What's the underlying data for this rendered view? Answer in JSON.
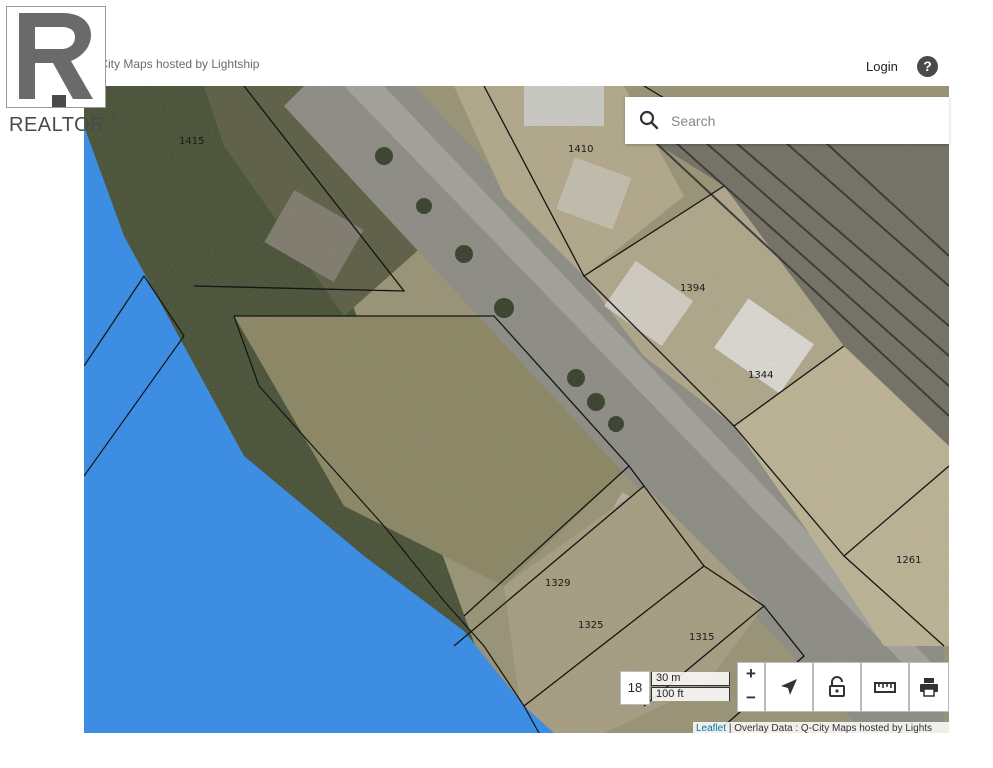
{
  "header": {
    "hosted_text": "Q-City Maps hosted by Lightship",
    "login_label": "Login",
    "help_label": "?"
  },
  "search": {
    "placeholder": "Search",
    "icon": "search-icon"
  },
  "map": {
    "parcel_labels": [
      "1415",
      "1410",
      "1394",
      "1344",
      "1329",
      "1325",
      "1315",
      "1261"
    ],
    "water_color": "#3d8ee3",
    "parcel_line_color": "#141414"
  },
  "controls": {
    "zoom_level": "18",
    "scale_metric": "30 m",
    "scale_imperial": "100 ft",
    "zoom_in": "+",
    "zoom_out": "−",
    "buttons": [
      "locate-icon",
      "lock-icon",
      "ruler-icon",
      "print-icon"
    ]
  },
  "attribution": {
    "leaflet": "Leaflet",
    "overlay": "| Overlay Data : Q-City Maps hosted by Lights"
  },
  "watermark": {
    "brand": "REALTOR",
    "mark": "®"
  }
}
